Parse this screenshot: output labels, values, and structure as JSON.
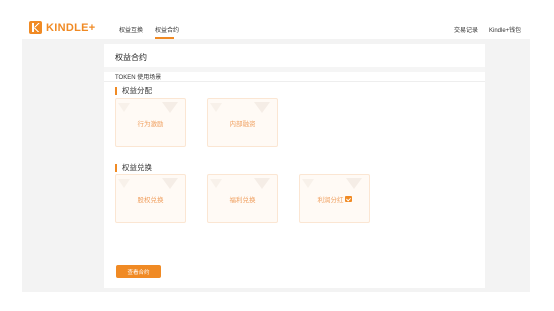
{
  "brand": {
    "name": "KINDLE+",
    "accent": "#f08a24"
  },
  "nav": {
    "items": [
      {
        "label": "权益互换"
      },
      {
        "label": "权益合约",
        "active": true
      }
    ],
    "right_items": [
      {
        "label": "交易记录"
      },
      {
        "label": "Kindle+钱包"
      }
    ]
  },
  "panel": {
    "title": "权益合约",
    "subtitle": "TOKEN 使用场景"
  },
  "sections": [
    {
      "heading": "权益分配",
      "cards": [
        {
          "label": "行为激励"
        },
        {
          "label": "内部融资"
        }
      ]
    },
    {
      "heading": "权益兑换",
      "cards": [
        {
          "label": "股权兑换"
        },
        {
          "label": "福利兑换"
        },
        {
          "label": "利润分红",
          "checked": true
        }
      ]
    }
  ],
  "actions": {
    "view_contract_label": "查看合约"
  }
}
